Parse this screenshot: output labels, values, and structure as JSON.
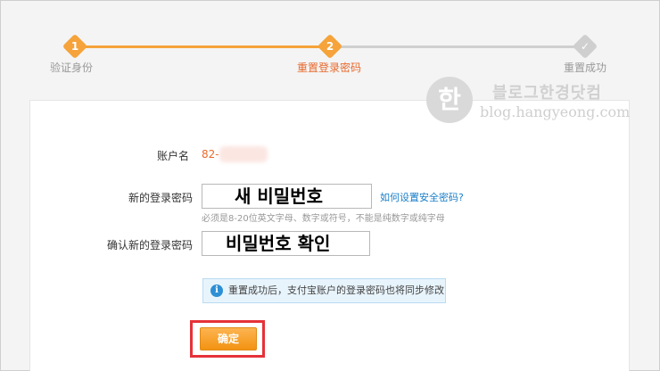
{
  "steps": [
    {
      "number": "1",
      "label": "验证身份",
      "state": "done"
    },
    {
      "number": "2",
      "label": "重置登录密码",
      "state": "active"
    },
    {
      "icon": "checkmark-icon",
      "label": "重置成功",
      "state": "pending"
    }
  ],
  "colors": {
    "accent": "#f5a33a",
    "accent_text": "#e8692c",
    "inactive": "#cfcfcf",
    "link": "#1a7ec8",
    "highlight": "#e53238"
  },
  "watermark": {
    "logo_glyph": "한",
    "title": "블로그한경닷컴",
    "url": "blog.hangyeong.com"
  },
  "form": {
    "account_label": "账户名",
    "account_value": "82-",
    "new_password_label": "新的登录密码",
    "new_password_value": "새 비밀번호",
    "help_link": "如何设置安全密码?",
    "hint": "必须是8-20位英文字母、数字或符号，不能是纯数字或纯字母",
    "confirm_label": "确认新的登录密码",
    "confirm_value": "비밀번호 확인",
    "info_text": "重置成功后，支付宝账户的登录密码也将同步修改",
    "submit_label": "确定"
  }
}
